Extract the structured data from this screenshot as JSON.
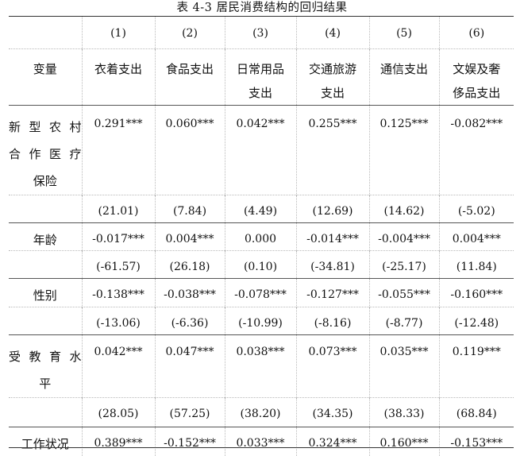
{
  "caption": "表 4-3    居民消费结构的回归结果",
  "col_numbers": [
    "(1)",
    "(2)",
    "(3)",
    "(4)",
    "(5)",
    "(6)"
  ],
  "variable_header": "变量",
  "col_names": [
    [
      "衣着支出"
    ],
    [
      "食品支出"
    ],
    [
      "日常用品",
      "支出"
    ],
    [
      "交通旅游",
      "支出"
    ],
    [
      "通信支出"
    ],
    [
      "文娱及奢",
      "侈品支出"
    ]
  ],
  "rows": [
    {
      "name": [
        "新型农村",
        "合作医疗",
        "保险"
      ],
      "coefs": [
        "0.291***",
        "0.060***",
        "0.042***",
        "0.255***",
        "0.125***",
        "-0.082***"
      ],
      "tstats": [
        "(21.01)",
        "(7.84)",
        "(4.49)",
        "(12.69)",
        "(14.62)",
        "(-5.02)"
      ]
    },
    {
      "name": [
        "年龄"
      ],
      "coefs": [
        "-0.017***",
        "0.004***",
        "0.000",
        "-0.014***",
        "-0.004***",
        "0.004***"
      ],
      "tstats": [
        "(-61.57)",
        "(26.18)",
        "(0.10)",
        "(-34.81)",
        "(-25.17)",
        "(11.84)"
      ]
    },
    {
      "name": [
        "性别"
      ],
      "coefs": [
        "-0.138***",
        "-0.038***",
        "-0.078***",
        "-0.127***",
        "-0.055***",
        "-0.160***"
      ],
      "tstats": [
        "(-13.06)",
        "(-6.36)",
        "(-10.99)",
        "(-8.16)",
        "(-8.77)",
        "(-12.48)"
      ]
    },
    {
      "name": [
        "受教育水",
        "平"
      ],
      "coefs": [
        "0.042***",
        "0.047***",
        "0.038***",
        "0.073***",
        "0.035***",
        "0.119***"
      ],
      "tstats": [
        "(28.05)",
        "(57.25)",
        "(38.20)",
        "(34.35)",
        "(38.33)",
        "(68.84)"
      ]
    },
    {
      "name": [
        "工作状况"
      ],
      "coefs": [
        "0.389***",
        "-0.152***",
        "0.033***",
        "0.324***",
        "0.160***",
        "-0.153***"
      ],
      "tstats": []
    }
  ]
}
